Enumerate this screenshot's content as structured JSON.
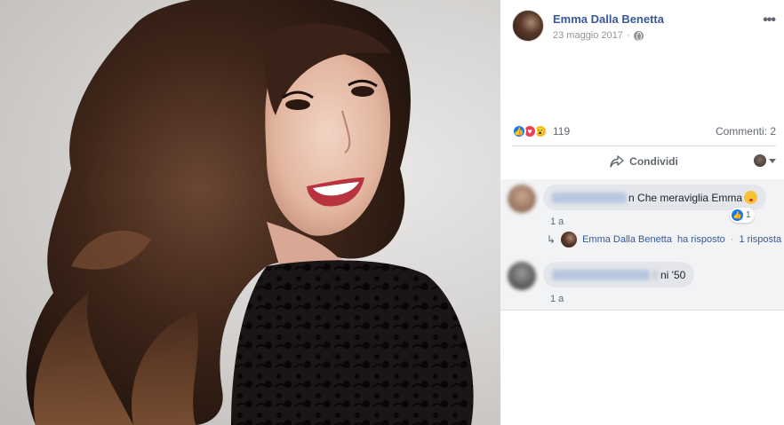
{
  "post": {
    "author": "Emma Dalla Benetta",
    "date": "23 maggio 2017",
    "more_label": "•••"
  },
  "reactions": {
    "count": "119",
    "comments_label": "Commenti: 2",
    "icons": [
      "like-icon",
      "love-icon",
      "wow-icon"
    ],
    "like_glyph": "👍",
    "love_glyph": "♥",
    "wow_glyph": "😮"
  },
  "actions": {
    "share_label": "Condividi"
  },
  "comments": [
    {
      "name_tail": "n",
      "text": "Che meraviglia Emma",
      "time": "1 a",
      "likes": "1",
      "reply": {
        "author": "Emma Dalla Benetta",
        "action": "ha risposto",
        "separator": "·",
        "count": "1 risposta"
      }
    },
    {
      "name_tail": "",
      "text": "ni '50",
      "time": "1 a"
    }
  ],
  "colors": {
    "link": "#385898",
    "like": "#1877f2",
    "love": "#f33e58",
    "wow": "#f7b928"
  }
}
